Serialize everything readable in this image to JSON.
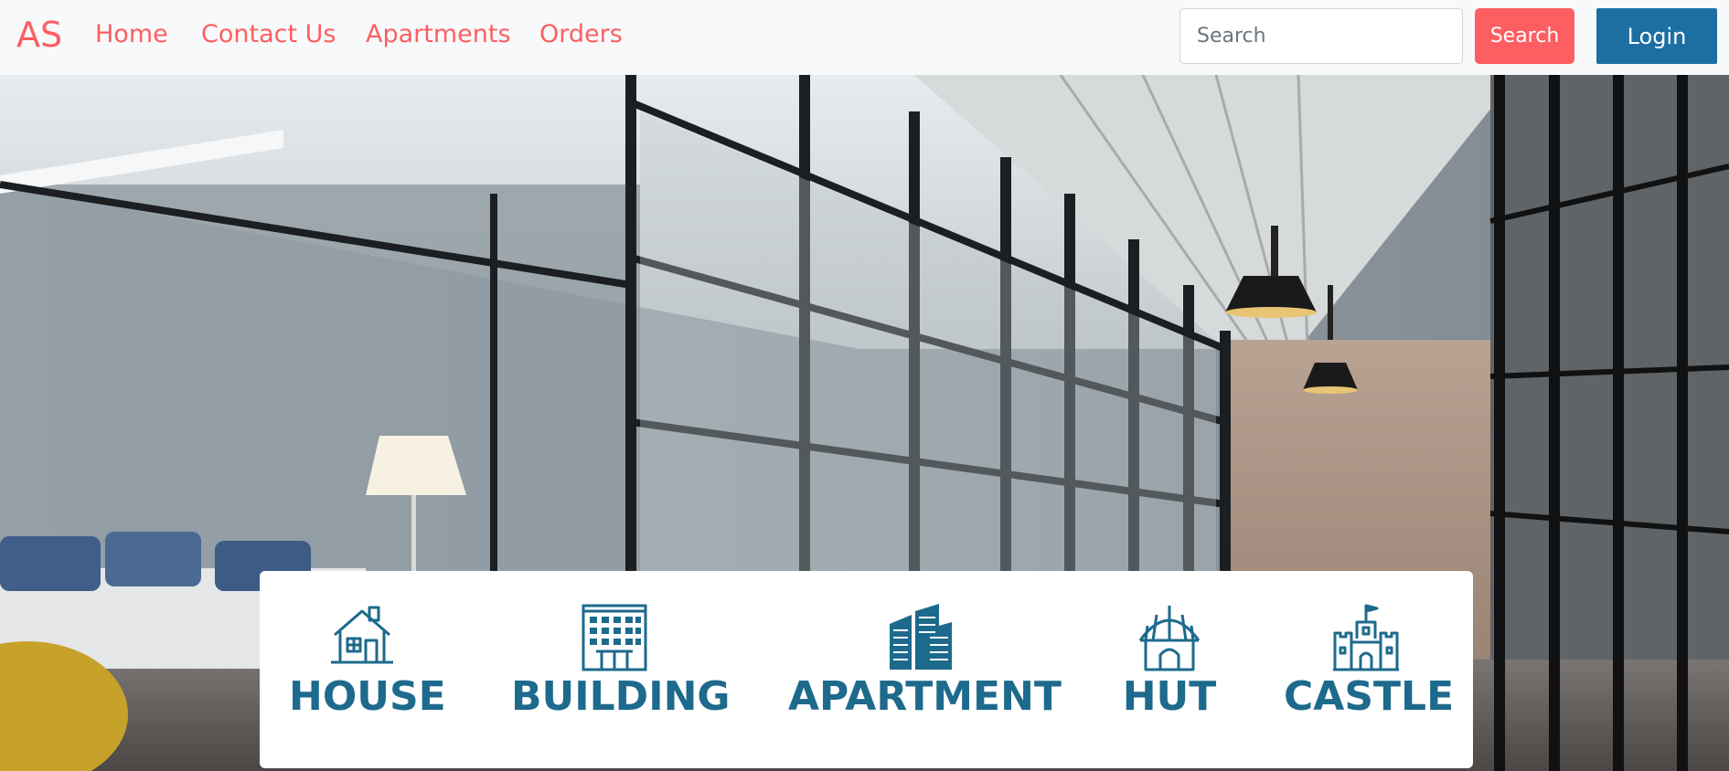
{
  "navbar": {
    "brand": "AS",
    "links": [
      {
        "label": "Home"
      },
      {
        "label": "Contact Us"
      },
      {
        "label": "Apartments"
      },
      {
        "label": "Orders"
      }
    ],
    "search": {
      "placeholder": "Search",
      "value": "",
      "button_label": "Search"
    },
    "login_label": "Login"
  },
  "colors": {
    "accent": "#fd5e62",
    "primary": "#1d6fa3",
    "category_text": "#1d6a8c",
    "navbar_bg": "#f8f9fa"
  },
  "hero": {
    "image": "office-corridor-glass-walls-photo"
  },
  "categories": [
    {
      "label": "HOUSE",
      "icon": "house-icon"
    },
    {
      "label": "BUILDING",
      "icon": "building-icon"
    },
    {
      "label": "APARTMENT",
      "icon": "apartment-icon"
    },
    {
      "label": "HUT",
      "icon": "hut-icon"
    },
    {
      "label": "CASTLE",
      "icon": "castle-icon"
    }
  ]
}
